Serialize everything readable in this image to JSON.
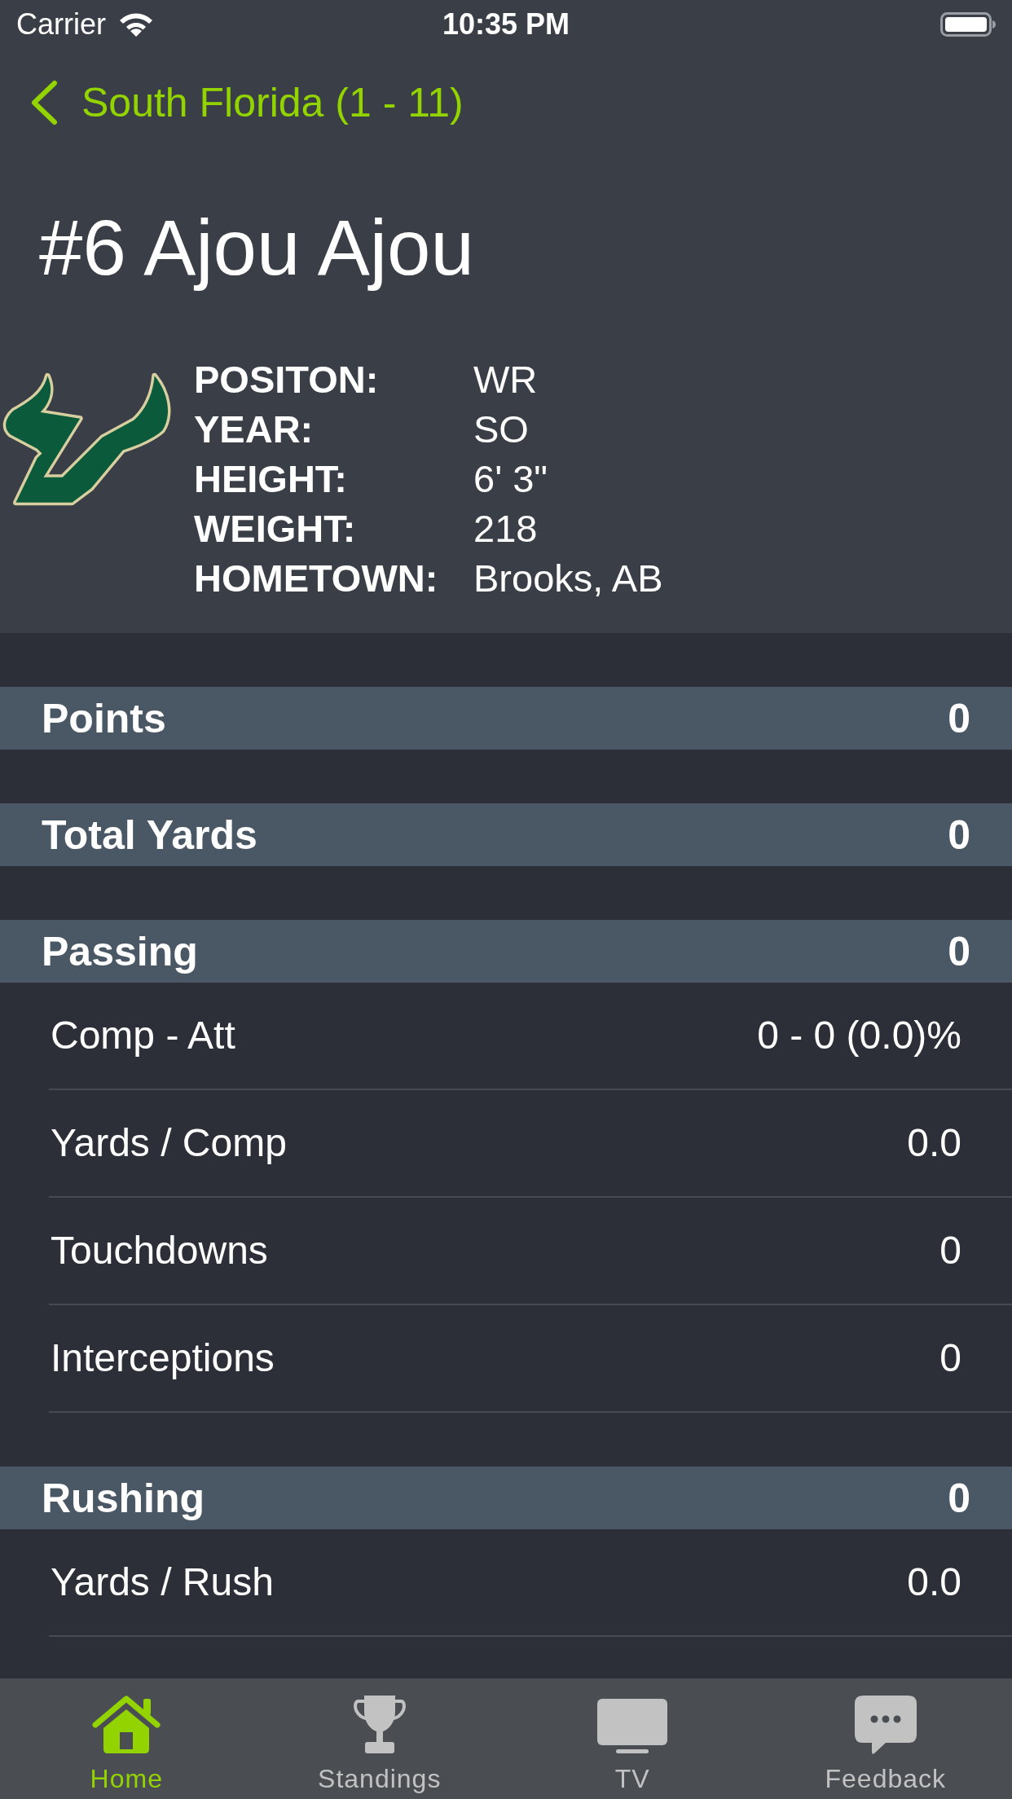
{
  "status_bar": {
    "carrier": "Carrier",
    "time": "10:35 PM"
  },
  "nav_bar": {
    "back_label": "South Florida (1 - 11)"
  },
  "player": {
    "title": "#6 Ajou Ajou",
    "details": [
      {
        "label": "POSITON:",
        "value": "WR"
      },
      {
        "label": "YEAR:",
        "value": "SO"
      },
      {
        "label": "HEIGHT:",
        "value": "6' 3\""
      },
      {
        "label": "WEIGHT:",
        "value": "218"
      },
      {
        "label": "HOMETOWN:",
        "value": "Brooks, AB"
      }
    ]
  },
  "sections": [
    {
      "title": "Points",
      "value": "0"
    },
    {
      "title": "Total Yards",
      "value": "0"
    },
    {
      "title": "Passing",
      "value": "0",
      "rows": [
        {
          "label": "Comp - Att",
          "value": "0 - 0 (0.0)%"
        },
        {
          "label": "Yards / Comp",
          "value": "0.0"
        },
        {
          "label": "Touchdowns",
          "value": "0"
        },
        {
          "label": "Interceptions",
          "value": "0"
        }
      ]
    },
    {
      "title": "Rushing",
      "value": "0",
      "rows": [
        {
          "label": "Yards / Rush",
          "value": "0.0"
        }
      ]
    }
  ],
  "tab_bar": [
    {
      "label": "Home",
      "selected": true
    },
    {
      "label": "Standings",
      "selected": false
    },
    {
      "label": "TV",
      "selected": false
    },
    {
      "label": "Feedback",
      "selected": false
    }
  ]
}
